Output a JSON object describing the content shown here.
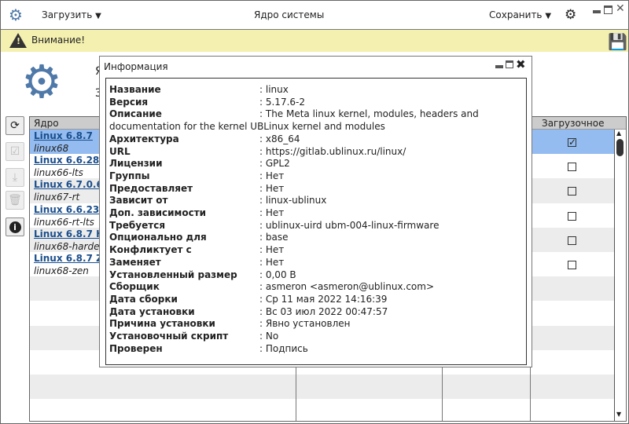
{
  "app": {
    "title": "Ядро системы",
    "load_menu": "Загрузить",
    "save_menu": "Сохранить"
  },
  "warning": {
    "text": "Внимание!"
  },
  "background": {
    "label1": "Я",
    "label2": "З"
  },
  "table": {
    "headers": [
      "Ядро",
      "",
      "",
      "Загрузочное"
    ],
    "rows": [
      {
        "name": "Linux 6.8.7",
        "pkg": "linux68",
        "boot": true,
        "selected": true
      },
      {
        "name": "Linux 6.6.28-1",
        "pkg": "linux66-lts",
        "boot": false
      },
      {
        "name": "Linux 6.7.0.6 l",
        "pkg": "linux67-rt",
        "boot": false
      },
      {
        "name": "Linux 6.6.23 R",
        "pkg": "linux66-rt-lts",
        "boot": false
      },
      {
        "name": "Linux 6.8.7 Ha",
        "pkg": "linux68-harden",
        "boot": false
      },
      {
        "name": "Linux 6.8.7 ZE",
        "pkg": "linux68-zen",
        "boot": false
      }
    ]
  },
  "dialog": {
    "title": "Информация",
    "fields": [
      {
        "k": "Название",
        "v": ": linux"
      },
      {
        "k": "Версия",
        "v": ": 5.17.6-2"
      },
      {
        "k": "Описание",
        "v": ": The Meta linux kernel, modules, headers and"
      },
      {
        "k": "documentation for the kernel UBLinux kernel and modules",
        "v": ""
      },
      {
        "k": "Архитектура",
        "v": ": x86_64"
      },
      {
        "k": "URL",
        "v": ": https://gitlab.ublinux.ru/linux/"
      },
      {
        "k": "Лицензии",
        "v": ": GPL2"
      },
      {
        "k": "Группы",
        "v": ": Нет"
      },
      {
        "k": "Предоставляет",
        "v": ": Нет"
      },
      {
        "k": "Зависит от",
        "v": ": linux-ublinux"
      },
      {
        "k": "Доп. зависимости",
        "v": ": Нет"
      },
      {
        "k": "Требуется",
        "v": ": ublinux-uird  ubm-004-linux-firmware"
      },
      {
        "k": "Опционально для",
        "v": ": base"
      },
      {
        "k": "Конфликтует с",
        "v": ": Нет"
      },
      {
        "k": "Заменяет",
        "v": ": Нет"
      },
      {
        "k": "Установленный размер",
        "v": ": 0,00 B"
      },
      {
        "k": "Сборщик",
        "v": ": asmeron <asmeron@ublinux.com>"
      },
      {
        "k": "Дата сборки",
        "v": ": Ср 11 мая 2022 14:16:39"
      },
      {
        "k": "Дата установки",
        "v": ": Вс 03 июл 2022 00:47:57"
      },
      {
        "k": "Причина установки",
        "v": ": Явно установлен"
      },
      {
        "k": "Установочный скрипт",
        "v": ": No"
      },
      {
        "k": "Проверен",
        "v": ": Подпись"
      }
    ]
  },
  "colors": {
    "accent": "#4f79a8",
    "selected": "#94bcf0",
    "warning_bg": "#f4f0b0",
    "link": "#1a4e8c"
  }
}
